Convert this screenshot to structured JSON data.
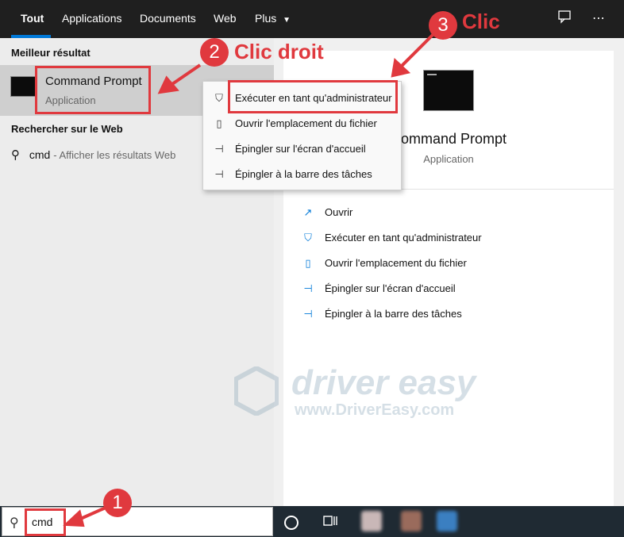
{
  "tabs": [
    {
      "label": "Tout",
      "active": true
    },
    {
      "label": "Applications"
    },
    {
      "label": "Documents"
    },
    {
      "label": "Web"
    },
    {
      "label": "Plus"
    }
  ],
  "top_icons": [
    "feedback-icon",
    "more-icon"
  ],
  "left": {
    "best_header": "Meilleur résultat",
    "best": {
      "title": "Command Prompt",
      "subtitle": "Application"
    },
    "web_header": "Rechercher sur le Web",
    "web_query": "cmd",
    "web_suffix": "- Afficher les résultats Web"
  },
  "context_menu": [
    {
      "label": "Exécuter en tant qu'administrateur",
      "icon": "admin-shield-icon"
    },
    {
      "label": "Ouvrir l'emplacement du fichier",
      "icon": "file-location-icon"
    },
    {
      "label": "Épingler sur l'écran d'accueil",
      "icon": "pin-start-icon"
    },
    {
      "label": "Épingler à la barre des tâches",
      "icon": "pin-taskbar-icon"
    }
  ],
  "right": {
    "title": "Command Prompt",
    "subtitle": "Application",
    "actions": [
      {
        "label": "Ouvrir",
        "icon": "open-icon"
      },
      {
        "label": "Exécuter en tant qu'administrateur",
        "icon": "admin-shield-icon"
      },
      {
        "label": "Ouvrir l'emplacement du fichier",
        "icon": "file-location-icon"
      },
      {
        "label": "Épingler sur l'écran d'accueil",
        "icon": "pin-start-icon"
      },
      {
        "label": "Épingler à la barre des tâches",
        "icon": "pin-taskbar-icon"
      }
    ]
  },
  "search": {
    "value": "cmd"
  },
  "annotations": {
    "step1": "1",
    "step2": "2",
    "step2_text": "Clic droit",
    "step3": "3",
    "step3_text": "Clic",
    "color": "#e0393e"
  },
  "watermark": {
    "main": "driver easy",
    "url": "www.DriverEasy.com"
  },
  "colors": {
    "accent": "#0078d7",
    "topbar": "#1f1f1f",
    "taskbar": "#1f2a33"
  }
}
